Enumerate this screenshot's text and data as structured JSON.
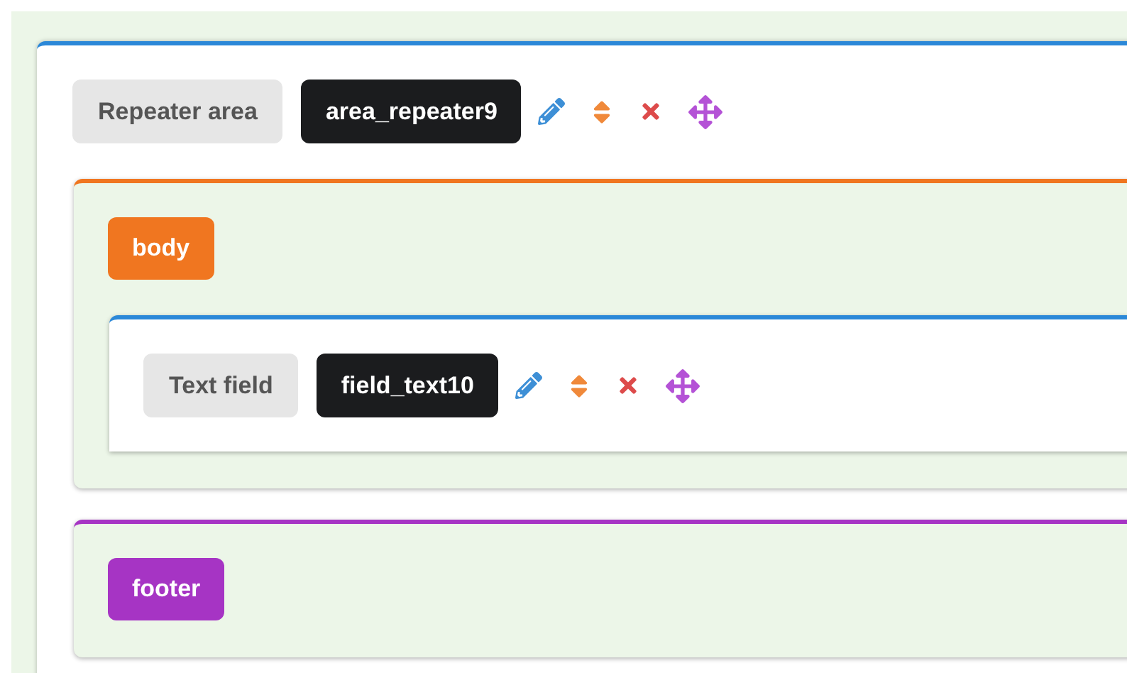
{
  "repeater": {
    "type_label": "Repeater area",
    "id": "area_repeater9",
    "sections": [
      {
        "name": "body",
        "color": "#f07620",
        "fields": [
          {
            "type_label": "Text field",
            "id": "field_text10"
          }
        ]
      },
      {
        "name": "footer",
        "color": "#a634c4"
      }
    ]
  }
}
